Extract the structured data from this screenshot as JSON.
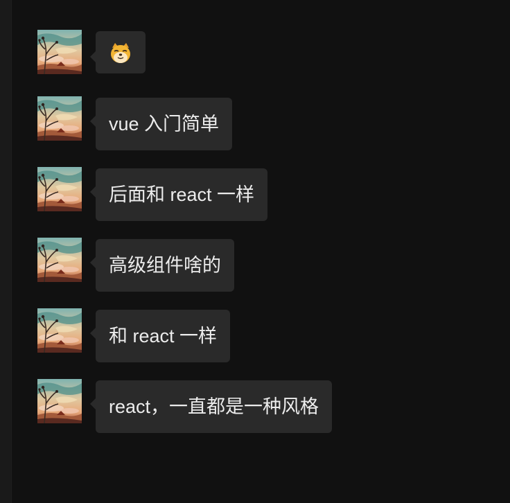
{
  "messages": [
    {
      "text": "",
      "emoji": "doge-face"
    },
    {
      "text": "vue 入门简单"
    },
    {
      "text": "后面和 react 一样"
    },
    {
      "text": "高级组件啥的"
    },
    {
      "text": "和 react 一样"
    },
    {
      "text": "react，一直都是一种风格"
    }
  ],
  "colors": {
    "background": "#111111",
    "bubble": "#2a2a2a",
    "text": "#ececec"
  }
}
